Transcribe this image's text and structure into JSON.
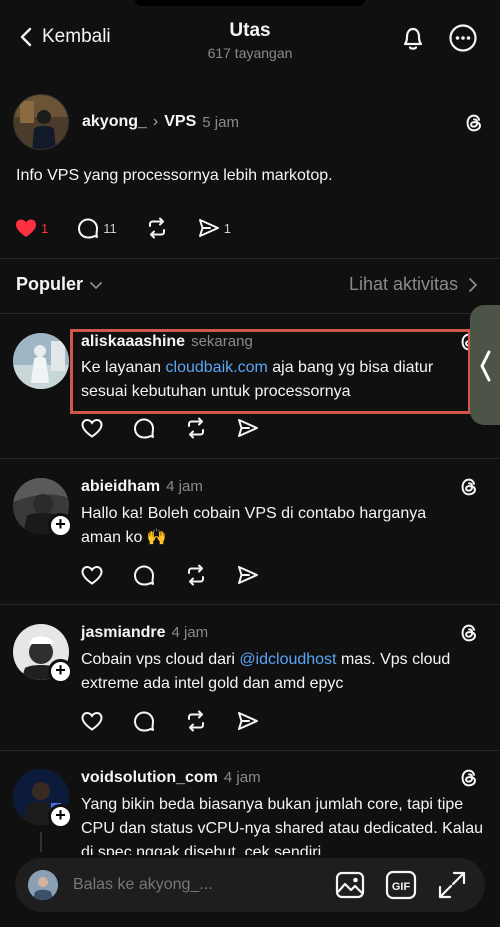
{
  "header": {
    "back_label": "Kembali",
    "title": "Utas",
    "views": "617 tayangan"
  },
  "post": {
    "username": "akyong_",
    "topic": "VPS",
    "time": "5 jam",
    "text": "Info VPS yang processornya lebih markotop.",
    "likes": "1",
    "replies": "11",
    "shares": "1"
  },
  "sort": {
    "label": "Populer",
    "activity_label": "Lihat aktivitas"
  },
  "replies": [
    {
      "username": "aliskaaashine",
      "time": "sekarang",
      "text_before": "Ke layanan ",
      "link": "cloudbaik.com",
      "text_after": "  aja bang yg bisa diatur sesuai kebutuhan untuk processornya"
    },
    {
      "username": "abieidham",
      "time": "4 jam",
      "text": "Hallo ka! Boleh cobain VPS di contabo harganya aman ko 🙌"
    },
    {
      "username": "jasmiandre",
      "time": "4 jam",
      "text_before": "Cobain vps cloud dari ",
      "mention": "@idcloudhost",
      "text_after": " mas. Vps cloud extreme ada intel gold dan amd epyc"
    },
    {
      "username": "voidsolution_com",
      "time": "4 jam",
      "text": "Yang bikin beda biasanya bukan jumlah core, tapi tipe CPU dan status vCPU-nya shared atau dedicated. Kalau di spec nggak disebut, cek sendiri"
    }
  ],
  "composer": {
    "placeholder": "Balas ke akyong_..."
  },
  "colors": {
    "background": "#101010",
    "like_red": "#ff3040",
    "link_blue": "#5aa5f5",
    "highlight_border": "#d0574a"
  }
}
